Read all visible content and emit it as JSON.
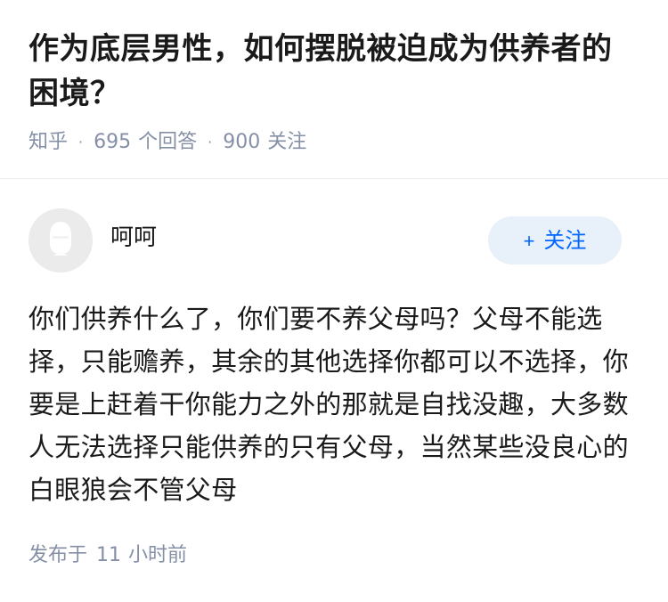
{
  "question": {
    "title": "作为底层男性，如何摆脱被迫成为供养者的困境？",
    "source": "知乎",
    "answer_count": "695",
    "answer_label": "个回答",
    "follower_count": "900",
    "follower_label": "关注",
    "separator": "·"
  },
  "answer": {
    "author_name": "呵呵",
    "avatar_icon": "default-avatar-icon",
    "follow_plus": "+",
    "follow_label": "关注",
    "body": "你们供养什么了，你们要不养父母吗？父母不能选择，只能赡养，其余的其他选择你都可以不选择，你要是上赶着干你能力之外的那就是自找没趣，大多数人无法选择只能供养的只有父母，当然某些没良心的白眼狼会不管父母",
    "posted_prefix": "发布于",
    "posted_num": "11",
    "posted_suffix": "小时前"
  },
  "colors": {
    "accent": "#0066ff",
    "follow_bg": "#e8f0fa",
    "meta_gray": "#8590a6",
    "divider": "#ededed"
  }
}
